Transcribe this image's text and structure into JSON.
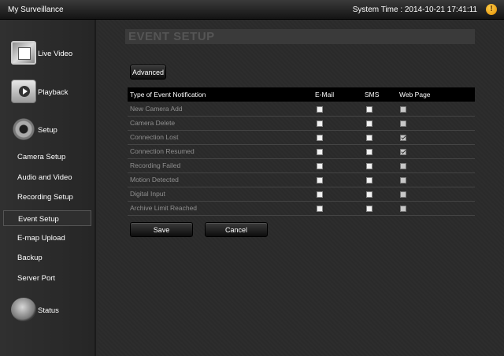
{
  "header": {
    "app_title": "My Surveillance",
    "system_time": "System Time : 2014-10-21 17:41:11",
    "alert_glyph": "!"
  },
  "sidebar": {
    "major": [
      {
        "label": "Live Video",
        "icon": "live-video-icon"
      },
      {
        "label": "Playback",
        "icon": "playback-icon"
      },
      {
        "label": "Setup",
        "icon": "gear-icon"
      },
      {
        "label": "Status",
        "icon": "status-icon"
      }
    ],
    "setup_items": [
      {
        "label": "Camera Setup"
      },
      {
        "label": "Audio and Video"
      },
      {
        "label": "Recording Setup"
      },
      {
        "label": "Event Setup",
        "active": true
      },
      {
        "label": "E-map Upload"
      },
      {
        "label": "Backup"
      },
      {
        "label": "Server Port"
      }
    ]
  },
  "main": {
    "page_title": "EVENT SETUP",
    "advanced_label": "Advanced",
    "save_label": "Save",
    "cancel_label": "Cancel",
    "table": {
      "headers": [
        "Type of Event Notification",
        "E-Mail",
        "SMS",
        "Web Page"
      ],
      "rows": [
        {
          "event": "New Camera Add",
          "email": false,
          "sms": false,
          "web": false
        },
        {
          "event": "Camera Delete",
          "email": false,
          "sms": false,
          "web": false
        },
        {
          "event": "Connection Lost",
          "email": false,
          "sms": false,
          "web": true
        },
        {
          "event": "Connection Resumed",
          "email": false,
          "sms": false,
          "web": true
        },
        {
          "event": "Recording Failed",
          "email": false,
          "sms": false,
          "web": false
        },
        {
          "event": "Motion Detected",
          "email": false,
          "sms": false,
          "web": false
        },
        {
          "event": "Digital Input",
          "email": false,
          "sms": false,
          "web": false
        },
        {
          "event": "Archive Limit Reached",
          "email": false,
          "sms": false,
          "web": false
        }
      ]
    }
  },
  "colors": {
    "background": "#2b2b2b",
    "topbar": "#141414",
    "table_header": "#000000",
    "alert": "#e08a00"
  }
}
